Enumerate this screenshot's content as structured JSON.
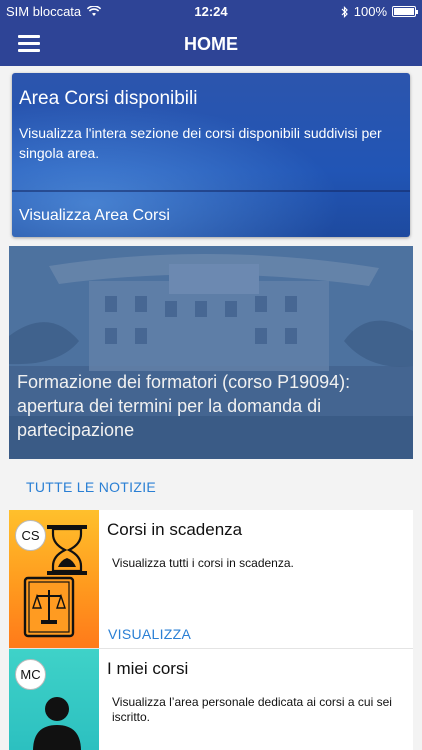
{
  "status_bar": {
    "carrier": "SIM bloccata",
    "time": "12:24",
    "battery_percent_label": "100%",
    "battery_level": 1.0,
    "wifi_icon": "wifi-icon",
    "bluetooth_icon": "bluetooth-icon"
  },
  "nav": {
    "title": "HOME",
    "menu_icon": "hamburger-icon"
  },
  "area_card": {
    "title": "Area Corsi disponibili",
    "description": "Visualizza l'intera sezione dei corsi disponibili suddivisi per singola area.",
    "link_label": "Visualizza Area Corsi"
  },
  "news": {
    "headline": "Formazione dei formatori (corso P19094): apertura dei termini per la domanda di partecipazione",
    "all_news_label": "TUTTE LE NOTIZIE"
  },
  "list": [
    {
      "abbr": "CS",
      "title": "Corsi in scadenza",
      "description": "Visualizza tutti i corsi in scadenza.",
      "link_label": "VISUALIZZA",
      "icon": "hourglass-book-icon"
    },
    {
      "abbr": "MC",
      "title": "I miei corsi",
      "description": "Visualizza l’area personale dedicata ai corsi a cui sei iscritto.",
      "icon": "user-icon"
    }
  ],
  "colors": {
    "primary": "#2e4496",
    "accent_link": "#2a7fd4",
    "orange": "#ff9a1e",
    "teal": "#2cc0c0"
  }
}
